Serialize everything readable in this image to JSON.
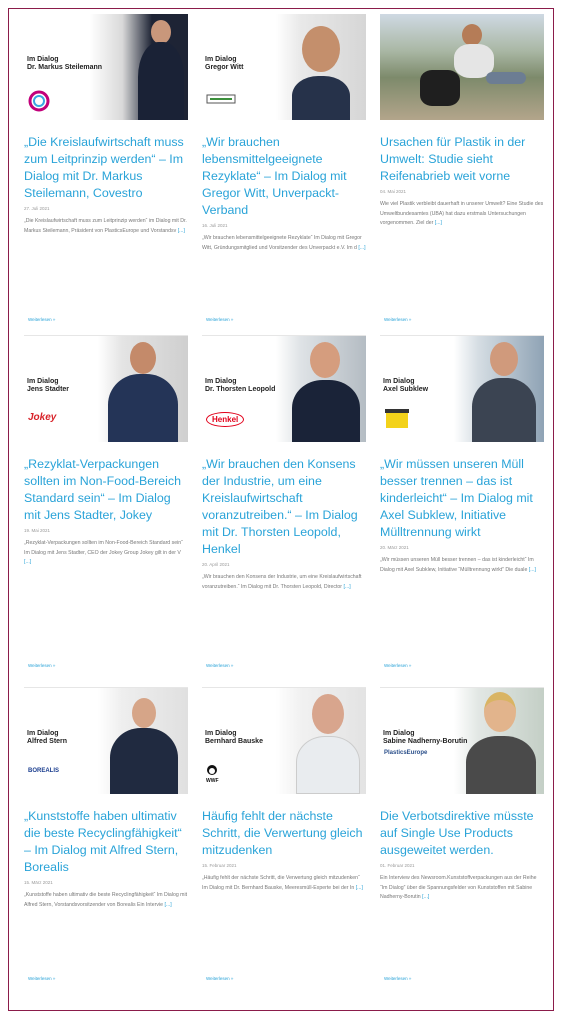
{
  "cards": [
    {
      "dialog_line1": "Im Dialog",
      "dialog_line2": "Dr. Markus Steilemann",
      "title": "„Die Kreislaufwirtschaft muss zum Leitprinzip werden“ – Im Dialog mit Dr. Markus Steilemann, Covestro",
      "date": "27. Juli 2021",
      "excerpt": "„Die Kreislaufwirtschaft muss zum Leitprinzip werden“ im Dialog mit Dr. Markus Steilemann, Präsident von PlasticsEurope und Vorstandsv",
      "more": "[...]",
      "readmore": "Weiterlesen »"
    },
    {
      "dialog_line1": "Im Dialog",
      "dialog_line2": "Gregor Witt",
      "title": "„Wir brauchen lebensmittelgeeignete Rezyklate“ – Im Dialog mit Gregor Witt, Unverpackt-Verband",
      "date": "16. Juli 2021",
      "excerpt": "„Wir brauchen lebensmittelgeeignete Rezyklate“ Im Dialog mit Gregor Witt, Gründungsmitglied und Vorsitzender des Unverpackt e.V. Im d",
      "more": "[...]",
      "readmore": "Weiterlesen »"
    },
    {
      "dialog_line1": "",
      "dialog_line2": "",
      "title": "Ursachen für Plastik in der Umwelt: Studie sieht Reifenabrieb weit vorne",
      "date": "04. Mai 2021",
      "excerpt": "Wie viel Plastik verbleibt dauerhaft in unserer Umwelt? Eine Studie des Umweltbundesamtes (UBA) hat dazu erstmals Untersuchungen vorgenommen. Ziel der",
      "more": "[...]",
      "readmore": "Weiterlesen »"
    },
    {
      "dialog_line1": "Im Dialog",
      "dialog_line2": "Jens Stadter",
      "logo": "Jokey",
      "title": "„Rezyklat-Verpackungen sollten im Non-Food-Bereich Standard sein“ – Im Dialog mit Jens Stadter, Jokey",
      "date": "19. Mai 2021",
      "excerpt": "„Rezyklat-Verpackungen sollten im Non-Food-Bereich Standard sein“ Im Dialog mit Jens Stadter, CEO der Jokey Group Jokey gilt in der V",
      "more": "[...]",
      "readmore": "Weiterlesen »"
    },
    {
      "dialog_line1": "Im Dialog",
      "dialog_line2": "Dr. Thorsten Leopold",
      "logo": "Henkel",
      "title": "„Wir brauchen den Konsens der Industrie, um eine Kreislaufwirtschaft voranzutreiben.“ – Im Dialog mit Dr. Thorsten Leopold, Henkel",
      "date": "20. April 2021",
      "excerpt": "„Wir brauchen den Konsens der Industrie, um eine Kreislaufwirtschaft voranzutreiben.“ Im Dialog mit Dr. Thorsten Leopold, Director",
      "more": "[...]",
      "readmore": "Weiterlesen »"
    },
    {
      "dialog_line1": "Im Dialog",
      "dialog_line2": "Axel Subklew",
      "title": "„Wir müssen unseren Müll besser trennen – das ist kinderleicht“ – Im Dialog mit Axel Subklew, Initiative Mülltrennung wirkt",
      "date": "20. März 2021",
      "excerpt": "„Wir müssen unseren Müll besser trennen – das ist kinderleicht“ Im Dialog mit Axel Subklew, Initiative “Mülltrennung wirkt” Die duale",
      "more": "[...]",
      "readmore": "Weiterlesen »"
    },
    {
      "dialog_line1": "Im Dialog",
      "dialog_line2": "Alfred Stern",
      "logo": "BOREALIS",
      "title": "„Kunststoffe haben ultimativ die beste Recyclingfähigkeit“ – Im Dialog mit Alfred Stern, Borealis",
      "date": "15. März 2021",
      "excerpt": "„Kunststoffe haben ultimativ die beste Recyclingfähigkeit“ Im Dialog mit Alfred Stern, Vorstandsvorsitzender von Borealis Ein Intervie",
      "more": "[...]",
      "readmore": "Weiterlesen »"
    },
    {
      "dialog_line1": "Im Dialog",
      "dialog_line2": "Bernhard Bauske",
      "logo": "WWF",
      "title": "Häufig fehlt der nächste Schritt, die Verwertung gleich mitzudenken",
      "date": "15. Februar 2021",
      "excerpt": "„Häufig fehlt der nächste Schritt, die Verwertung gleich mitzudenken“ Im Dialog mit Dr. Bernhard Bauske, Meeresmüll-Experte bei der In",
      "more": "[...]",
      "readmore": "Weiterlesen »"
    },
    {
      "dialog_line1": "Im Dialog",
      "dialog_line2": "Sabine Nadherny-Borutin",
      "logo": "PlasticsEurope",
      "title": "Die Verbotsdirektive müsste auf Single Use Products ausgeweitet werden.",
      "date": "01. Februar 2021",
      "excerpt": "Ein Interview des Newsroom.Kunststoffverpackungen aus der Reihe “Im Dialog” über die Spannungsfelder von Kunststoffen mit Sabine Nadherny-Borutin",
      "more": "[...]",
      "readmore": "Weiterlesen »"
    }
  ],
  "colors": {
    "accent": "#29a3d8",
    "frame": "#8b1c4a"
  }
}
